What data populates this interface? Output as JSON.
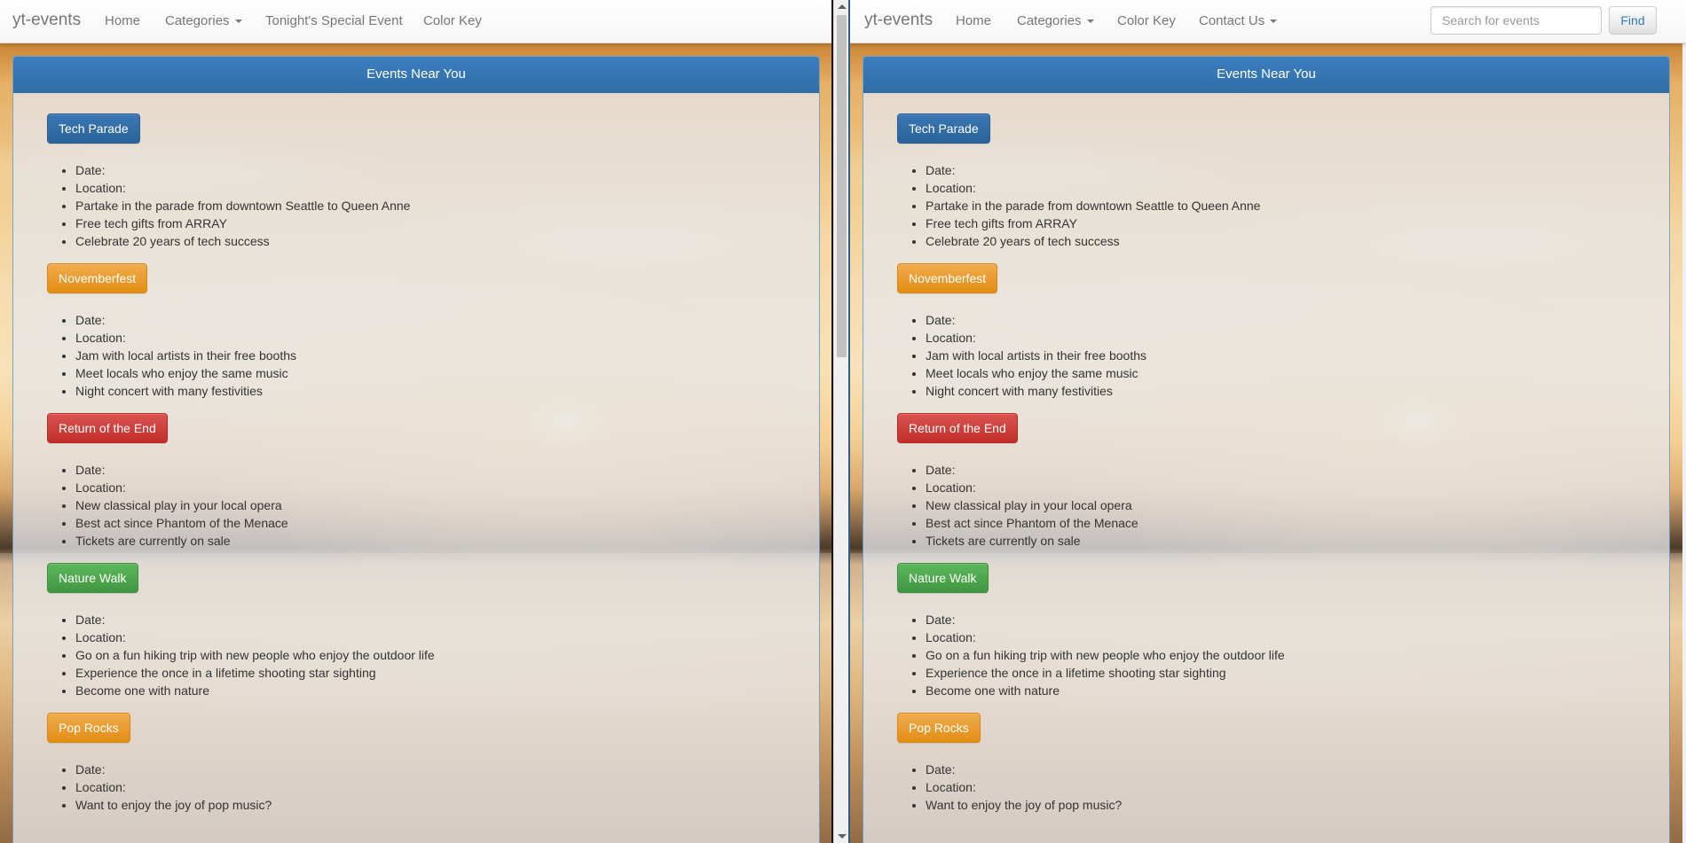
{
  "left_window": {
    "navbar": {
      "brand": "yt-events",
      "links": [
        "Home",
        "Categories",
        "Tonight's Special Event",
        "Color Key"
      ]
    },
    "panel": {
      "title": "Events Near You"
    }
  },
  "right_window": {
    "navbar": {
      "brand": "yt-events",
      "links": [
        "Home",
        "Categories",
        "Color Key",
        "Contact Us"
      ],
      "search_placeholder": "Search for events",
      "find_label": "Find"
    },
    "panel": {
      "title": "Events Near You"
    }
  },
  "events": [
    {
      "name": "Tech Parade",
      "color": "#337ab7",
      "details": [
        "Date:",
        "Location:",
        "Partake in the parade from downtown Seattle to Queen Anne",
        "Free tech gifts from ARRAY",
        "Celebrate 20 years of tech success"
      ]
    },
    {
      "name": "Novemberfest",
      "color": "#f0ad4e",
      "details": [
        "Date:",
        "Location:",
        "Jam with local artists in their free booths",
        "Meet locals who enjoy the same music",
        "Night concert with many festivities"
      ]
    },
    {
      "name": "Return of the End",
      "color": "#d9534f",
      "details": [
        "Date:",
        "Location:",
        "New classical play in your local opera",
        "Best act since Phantom of the Menace",
        "Tickets are currently on sale"
      ]
    },
    {
      "name": "Nature Walk",
      "color": "#5cb85c",
      "details": [
        "Date:",
        "Location:",
        "Go on a fun hiking trip with new people who enjoy the outdoor life",
        "Experience the once in a lifetime shooting star sighting",
        "Become one with nature"
      ]
    },
    {
      "name": "Pop Rocks",
      "color": "#f0ad4e",
      "details": [
        "Date:",
        "Location:",
        "Want to enjoy the joy of pop music?"
      ]
    }
  ]
}
